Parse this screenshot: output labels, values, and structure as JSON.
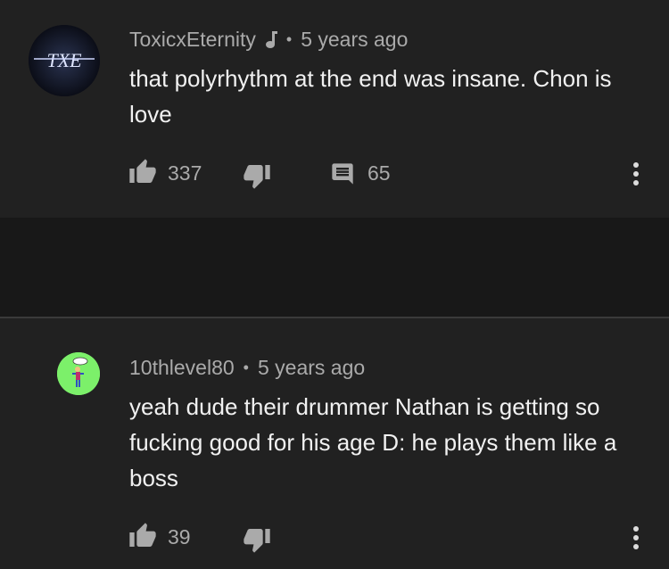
{
  "comments": [
    {
      "author": "ToxicxEternity",
      "author_badge": "music-note-icon",
      "separator": "•",
      "time": "5 years ago",
      "text": "that polyrhythm at the end was insane. Chon is love",
      "likes": "337",
      "replies": "65",
      "avatar_text": "TXE"
    },
    {
      "author": "10thlevel80",
      "separator": "•",
      "time": "5 years ago",
      "text": "yeah dude their drummer Nathan is getting so fucking good for his age D: he plays them like a boss",
      "likes": "39"
    }
  ],
  "colors": {
    "background": "#212121",
    "text": "#f1f1f1",
    "secondary_text": "#aaaaaa",
    "avatar2_bg": "#7cf06a"
  }
}
